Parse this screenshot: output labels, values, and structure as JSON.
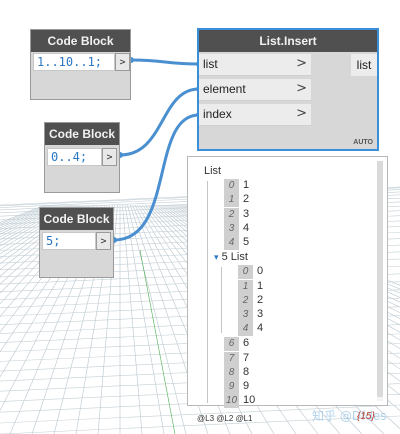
{
  "nodes": {
    "code_block_1": {
      "title": "Code Block",
      "code": "1..10..1;",
      "port": ">"
    },
    "code_block_2": {
      "title": "Code Block",
      "code": "0..4;",
      "port": ">"
    },
    "code_block_3": {
      "title": "Code Block",
      "code": "5;",
      "port": ">"
    },
    "list_insert": {
      "title": "List.Insert",
      "inputs": [
        "list",
        "element",
        "index"
      ],
      "input_arrow": ">",
      "output": "list",
      "lacing": "AUTO"
    }
  },
  "watch": {
    "root_label": "List",
    "items_before": [
      {
        "index": "0",
        "value": "1"
      },
      {
        "index": "1",
        "value": "2"
      },
      {
        "index": "2",
        "value": "3"
      },
      {
        "index": "3",
        "value": "4"
      },
      {
        "index": "4",
        "value": "5"
      }
    ],
    "sublist_index": "5",
    "sublist_label": "List",
    "sublist_toggle": "▾",
    "sublist_items": [
      {
        "index": "0",
        "value": "0"
      },
      {
        "index": "1",
        "value": "1"
      },
      {
        "index": "2",
        "value": "2"
      },
      {
        "index": "3",
        "value": "3"
      },
      {
        "index": "4",
        "value": "4"
      }
    ],
    "items_after": [
      {
        "index": "6",
        "value": "6"
      },
      {
        "index": "7",
        "value": "7"
      },
      {
        "index": "8",
        "value": "8"
      },
      {
        "index": "9",
        "value": "9"
      },
      {
        "index": "10",
        "value": "10"
      }
    ],
    "levels": "@L3 @L2 @L1",
    "count": "{15}"
  },
  "watermark": "知乎 @Dfdes",
  "colors": {
    "wire": "#4a8fd0",
    "node_header": "#505050",
    "node_body": "#d7d7d7",
    "selected_border": "#3a8fd8",
    "code_text": "#2b78c7",
    "count_text": "#c0392b"
  }
}
